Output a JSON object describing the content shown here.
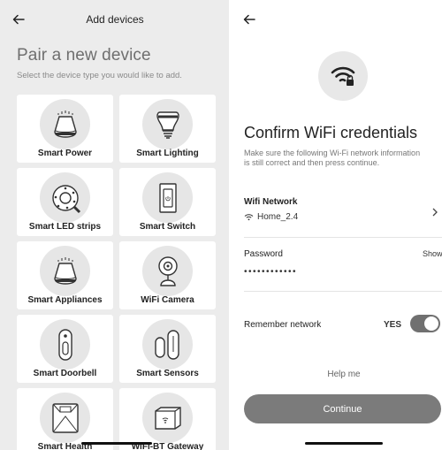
{
  "left_screen": {
    "header_title": "Add devices",
    "title": "Pair a new device",
    "subtitle": "Select the device type you would like to add.",
    "devices": [
      {
        "label": "Smart Power",
        "icon": "smart-power-icon"
      },
      {
        "label": "Smart Lighting",
        "icon": "smart-lighting-icon"
      },
      {
        "label": "Smart LED strips",
        "icon": "led-strip-icon"
      },
      {
        "label": "Smart Switch",
        "icon": "smart-switch-icon"
      },
      {
        "label": "Smart Appliances",
        "icon": "smart-appliances-icon"
      },
      {
        "label": "WiFi Camera",
        "icon": "wifi-camera-icon"
      },
      {
        "label": "Smart Doorbell",
        "icon": "doorbell-icon"
      },
      {
        "label": "Smart Sensors",
        "icon": "sensors-icon"
      },
      {
        "label": "Smart Health",
        "icon": "health-scale-icon"
      },
      {
        "label": "WiFi-BT Gateway",
        "icon": "gateway-icon"
      }
    ]
  },
  "right_screen": {
    "title": "Confirm WiFi credentials",
    "subtitle": "Make sure the following Wi-Fi network information is still correct and then press continue.",
    "wifi_network_label": "Wifi Network",
    "wifi_network_value": "Home_2.4",
    "password_label": "Password",
    "password_value": "••••••••••••",
    "show_label": "Show",
    "remember_label": "Remember network",
    "remember_state": "YES",
    "help_label": "Help me",
    "continue_label": "Continue"
  },
  "colors": {
    "left_background": "#ececec",
    "card_background": "#ffffff",
    "continue_button": "#7b7b7b",
    "toggle_on": "#707070"
  }
}
